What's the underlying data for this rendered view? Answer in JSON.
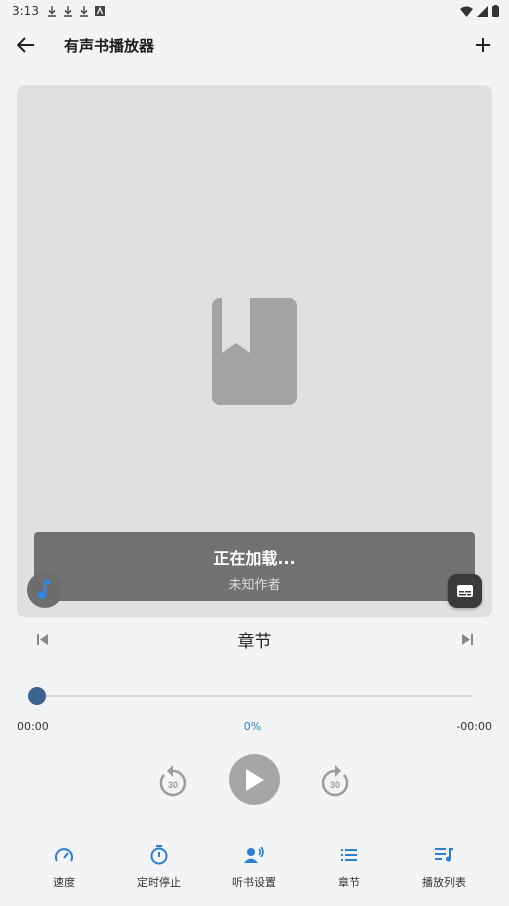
{
  "status_bar": {
    "time": "3:13"
  },
  "app_bar": {
    "title": "有声书播放器"
  },
  "player": {
    "book_title": "正在加载...",
    "book_author": "未知作者",
    "chapter_label": "章节",
    "position_time": "00:00",
    "progress_percent": "0%",
    "remaining_time": "-00:00",
    "progress_fraction": 0,
    "rewind_seconds": "30",
    "forward_seconds": "30"
  },
  "bottom_nav": {
    "speed": "速度",
    "sleep_timer": "定时停止",
    "listen_settings": "听书设置",
    "chapters": "章节",
    "playlist": "播放列表"
  },
  "colors": {
    "accent": "#2b7fd0",
    "thumb": "#3c6491",
    "cover_bg": "#e0e0e0"
  }
}
